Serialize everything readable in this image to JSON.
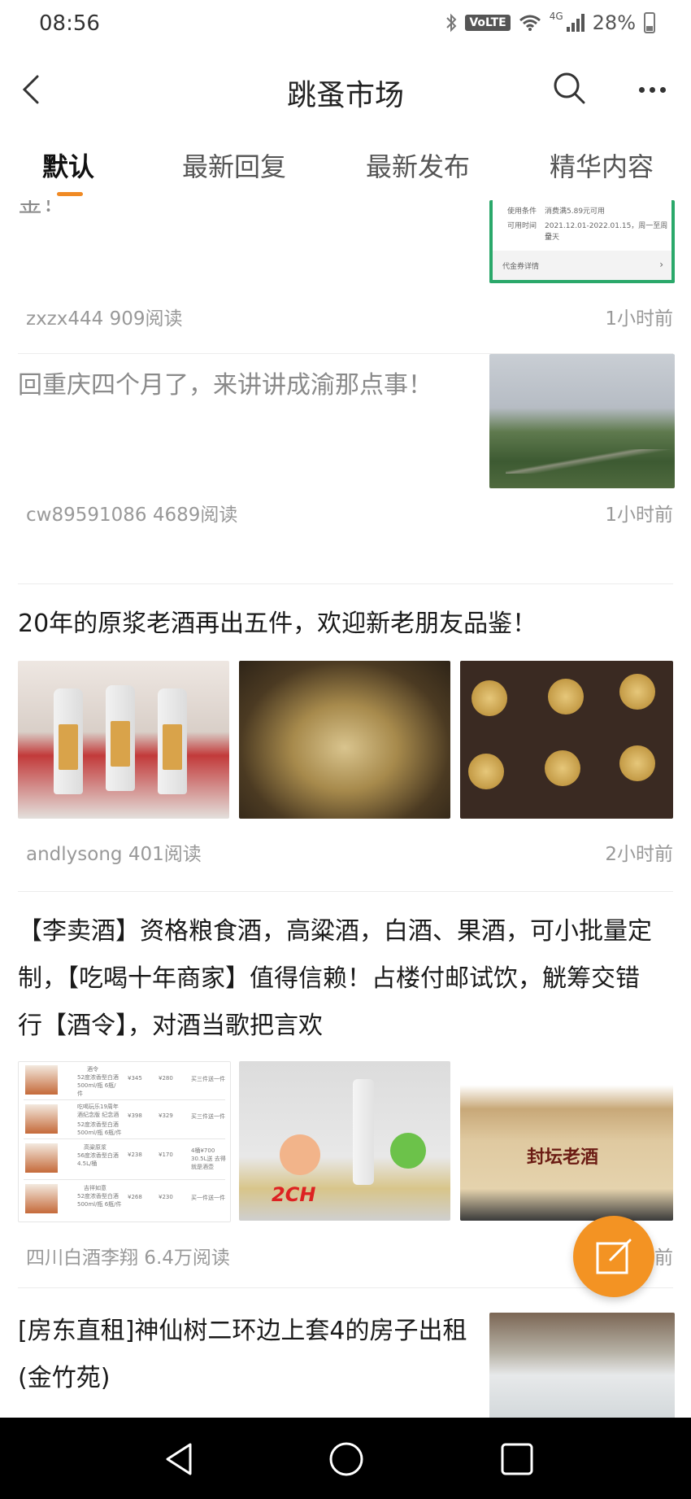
{
  "status": {
    "time": "08:56",
    "volte": "VoLTE",
    "network": "4G",
    "battery": "28%"
  },
  "header": {
    "title": "跳蚤市场"
  },
  "tabs": [
    {
      "label": "默认",
      "active": true
    },
    {
      "label": "最新回复",
      "active": false
    },
    {
      "label": "最新发布",
      "active": false
    },
    {
      "label": "精华内容",
      "active": false
    }
  ],
  "posts": [
    {
      "title": "金！",
      "author_reads": "zxzx444 909阅读",
      "time": "1小时前",
      "coupon": {
        "row1_label": "使用条件",
        "row1_value": "消费满5.89元可用",
        "row2_label": "可用时间",
        "row2_value": "2021.12.01-2022.01.15，周一至周日",
        "row2_value2": "全天",
        "footer": "代金券详情"
      }
    },
    {
      "title": "回重庆四个月了，来讲讲成渝那点事！",
      "author_reads": "cw89591086 4689阅读",
      "time": "1小时前"
    },
    {
      "title": "20年的原浆老酒再出五件，欢迎新老朋友品鉴！",
      "author_reads": "andlysong 401阅读",
      "time": "2小时前"
    },
    {
      "title": "【李卖酒】资格粮食酒，高粱酒，白酒、果酒，可小批量定制，【吃喝十年商家】值得信赖！占楼付邮试饮，觥筹交错行【酒令】，对酒当歌把言欢",
      "author_reads": "四川白酒李翔 6.4万阅读",
      "time": "前",
      "jar_label": "封坛老酒",
      "figures_label": "2CH",
      "price_list": {
        "rows": [
          {
            "name": "酒令",
            "spec": "52度浓香型白酒 500ml/瓶 6瓶/件",
            "orig": "¥345",
            "price": "¥280",
            "note": "买三件送一件"
          },
          {
            "name": "吃喝玩乐19周年 酒纪念版 纪念酒",
            "spec": "52度浓香型白酒 500ml/瓶 6瓶/件",
            "orig": "¥398",
            "price": "¥329",
            "note": "买三件送一件"
          },
          {
            "name": "高粱原浆",
            "spec": "56度浓香型白酒 4.5L/桶",
            "orig": "¥238",
            "price": "¥170",
            "note": "4桶¥700 30.5L送 去得就是酒壶"
          },
          {
            "name": "吉祥如意",
            "spec": "52度浓香型白酒 500ml/瓶 6瓶/件",
            "orig": "¥268",
            "price": "¥230",
            "note": "买一件送一件"
          }
        ]
      }
    },
    {
      "title": "[房东直租]神仙树二环边上套4的房子出租(金竹苑)"
    }
  ]
}
